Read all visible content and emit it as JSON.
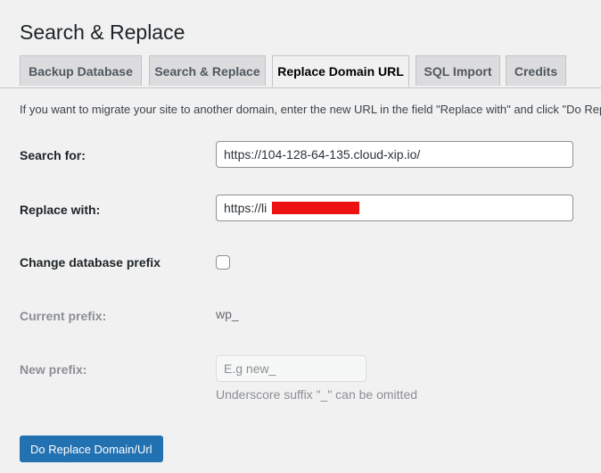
{
  "page": {
    "title": "Search & Replace"
  },
  "tabs": [
    {
      "label": "Backup Database",
      "active": false
    },
    {
      "label": "Search & Replace",
      "active": false
    },
    {
      "label": "Replace Domain URL",
      "active": true
    },
    {
      "label": "SQL Import",
      "active": false
    },
    {
      "label": "Credits",
      "active": false
    }
  ],
  "intro_text": "If you want to migrate your site to another domain, enter the new URL in the field \"Replace with\" and click \"Do Rep",
  "form": {
    "search_for": {
      "label": "Search for:",
      "value": "https://104-128-64-135.cloud-xip.io/"
    },
    "replace_with": {
      "label": "Replace with:",
      "value": "https://li",
      "redacted": true,
      "redaction_color": "#ee1111"
    },
    "change_prefix": {
      "label": "Change database prefix",
      "checked": false
    },
    "current_prefix": {
      "label": "Current prefix:",
      "value": "wp_"
    },
    "new_prefix": {
      "label": "New prefix:",
      "placeholder": "E.g new_",
      "hint": "Underscore suffix \"_\" can be omitted"
    }
  },
  "submit_label": "Do Replace Domain/Url",
  "colors": {
    "primary": "#2271b1",
    "background": "#f1f1f1",
    "tab_inactive": "#dcdcde"
  }
}
